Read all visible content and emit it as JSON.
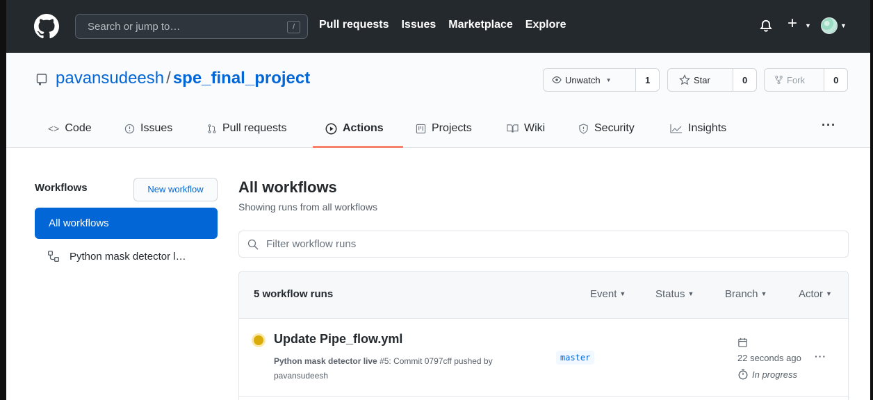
{
  "header": {
    "search_placeholder": "Search or jump to…",
    "search_shortcut": "/",
    "nav": [
      "Pull requests",
      "Issues",
      "Marketplace",
      "Explore"
    ]
  },
  "repo": {
    "owner": "pavansudeesh",
    "separator": "/",
    "name": "spe_final_project",
    "watch": {
      "label": "Unwatch",
      "count": "1"
    },
    "star": {
      "label": "Star",
      "count": "0"
    },
    "fork": {
      "label": "Fork",
      "count": "0"
    }
  },
  "tabs": [
    {
      "label": "Code",
      "icon": "code-icon"
    },
    {
      "label": "Issues",
      "icon": "issue-icon"
    },
    {
      "label": "Pull requests",
      "icon": "pull-request-icon"
    },
    {
      "label": "Actions",
      "icon": "play-icon",
      "active": true
    },
    {
      "label": "Projects",
      "icon": "project-icon"
    },
    {
      "label": "Wiki",
      "icon": "book-icon"
    },
    {
      "label": "Security",
      "icon": "shield-icon"
    },
    {
      "label": "Insights",
      "icon": "graph-icon"
    }
  ],
  "tabs_more": "···",
  "sidebar": {
    "title": "Workflows",
    "new_workflow": "New workflow",
    "all_workflows": "All workflows",
    "items": [
      {
        "label": "Python mask detector l…"
      }
    ]
  },
  "main": {
    "title": "All workflows",
    "subtitle": "Showing runs from all workflows",
    "filter_placeholder": "Filter workflow runs",
    "runs_count": "5 workflow runs",
    "filters": [
      "Event",
      "Status",
      "Branch",
      "Actor"
    ]
  },
  "runs": [
    {
      "title": "Update Pipe_flow.yml",
      "workflow": "Python mask detector live",
      "detail": "#5: Commit 0797cff pushed by",
      "actor": "pavansudeesh",
      "branch": "master",
      "time": "22 seconds ago",
      "status": "In progress",
      "status_color": "#dbab09"
    }
  ],
  "colors": {
    "accent": "#0366d6",
    "header_bg": "#24292e",
    "tab_underline": "#f9826c"
  }
}
